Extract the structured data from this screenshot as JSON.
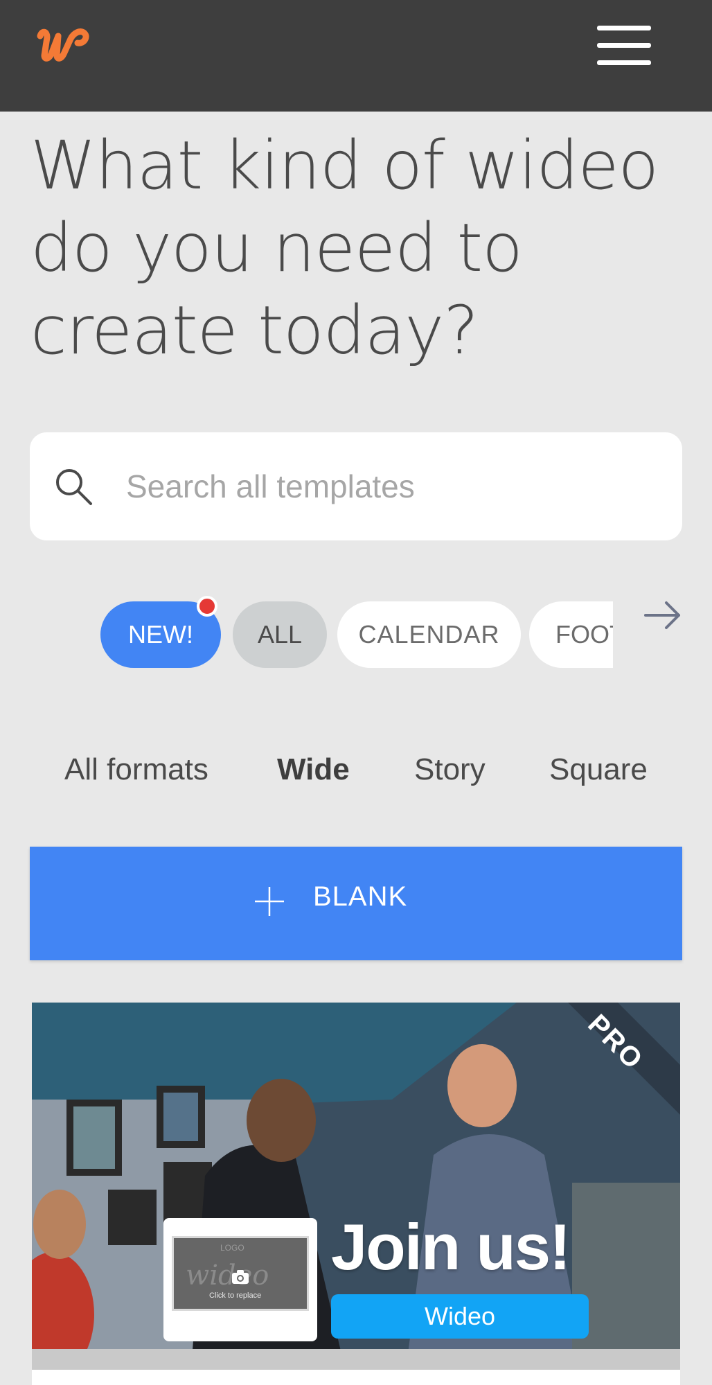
{
  "header": {
    "logo_icon": "wideo-w-logo-icon",
    "menu_icon": "hamburger-menu-icon",
    "logo_color": "#f47a36",
    "bar_color": "#3e3e3e"
  },
  "headline": {
    "line1": "What kind of wideo",
    "line2": "do you need to",
    "line3": "create today?"
  },
  "search": {
    "icon": "search-icon",
    "placeholder": "Search all templates",
    "value": ""
  },
  "categories": {
    "chips": [
      {
        "label": "NEW!",
        "active": true,
        "notification": true
      },
      {
        "label": "ALL",
        "selected": true
      },
      {
        "label": "CALENDAR"
      },
      {
        "label": "FOOT"
      }
    ],
    "next_icon": "arrow-right-icon",
    "accent": "#4285f4",
    "notification_color": "#e53935"
  },
  "formats": {
    "tabs": [
      "All formats",
      "Wide",
      "Story",
      "Square"
    ],
    "selected": "Wide"
  },
  "blank_button": {
    "icon": "plus-icon",
    "label": "BLANK",
    "color": "#4285f4"
  },
  "template_card": {
    "badge": "PRO",
    "title": "Join us!",
    "brand": "Wideo",
    "thumb_word": "wideo",
    "thumb_logo": "LOGO",
    "thumb_hint": "Click to replace",
    "thumb_icon": "camera-icon"
  }
}
